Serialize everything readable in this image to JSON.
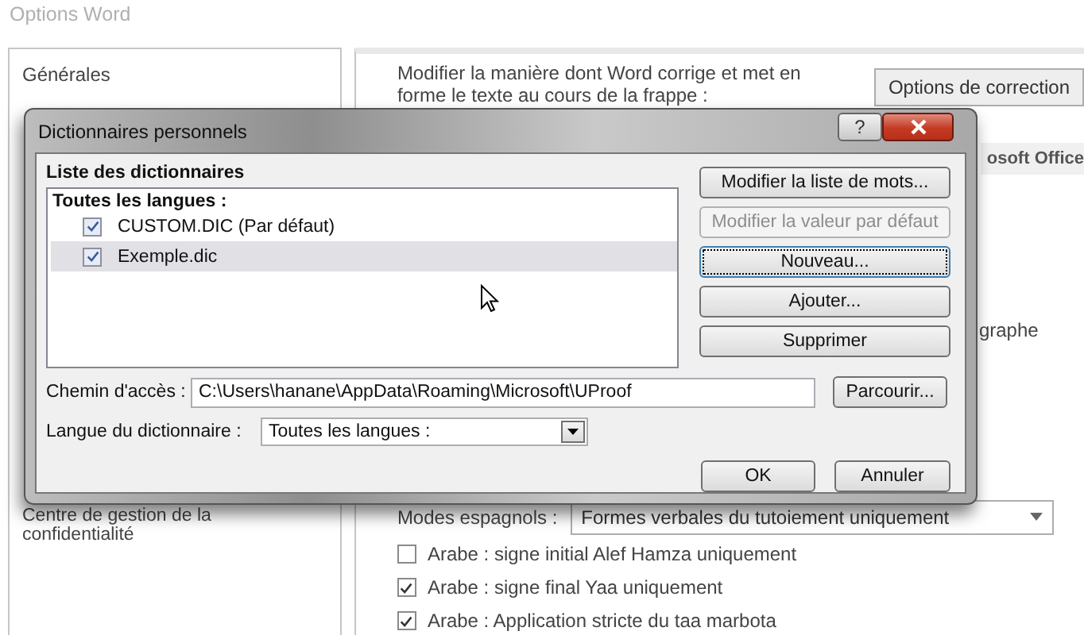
{
  "window": {
    "title": "Options Word"
  },
  "sidebar": {
    "items": [
      {
        "label": "Générales",
        "selected": false
      },
      {
        "label": "Centre de gestion de la confidentialité",
        "selected": false
      }
    ]
  },
  "main": {
    "description": [
      "Modifier la manière dont Word corrige et met en",
      "forme le texte au cours de la frappe :"
    ],
    "autocorrect_button": "Options de correction",
    "section_title": "osoft Office",
    "fragment": "graphe",
    "spanish_modes": {
      "label": "Modes espagnols :",
      "value": "Formes verbales du tutoiement uniquement"
    },
    "options": [
      {
        "label": "Arabe : signe initial Alef Hamza uniquement",
        "checked": false
      },
      {
        "label": "Arabe : signe final Yaa uniquement",
        "checked": true
      },
      {
        "label": "Arabe : Application stricte du taa marbota",
        "checked": true
      }
    ]
  },
  "dialog": {
    "title": "Dictionnaires personnels",
    "help": "?",
    "list_label": "Liste des dictionnaires",
    "group": "Toutes les langues :",
    "dictionaries": [
      {
        "name": "CUSTOM.DIC (Par défaut)",
        "checked": true,
        "selected": false
      },
      {
        "name": "Exemple.dic",
        "checked": true,
        "selected": true
      }
    ],
    "buttons": [
      {
        "label": "Modifier la liste de mots...",
        "disabled": false,
        "focused": false
      },
      {
        "label": "Modifier la valeur par défaut",
        "disabled": true,
        "focused": false
      },
      {
        "label": "Nouveau...",
        "disabled": false,
        "focused": true
      },
      {
        "label": "Ajouter...",
        "disabled": false,
        "focused": false
      },
      {
        "label": "Supprimer",
        "disabled": false,
        "focused": false
      }
    ],
    "path": {
      "label": "Chemin d'accès :",
      "value": "C:\\Users\\hanane\\AppData\\Roaming\\Microsoft\\UProof"
    },
    "browse": "Parcourir...",
    "language": {
      "label": "Langue du dictionnaire :",
      "value": "Toutes les langues :"
    },
    "ok": "OK",
    "cancel": "Annuler"
  }
}
